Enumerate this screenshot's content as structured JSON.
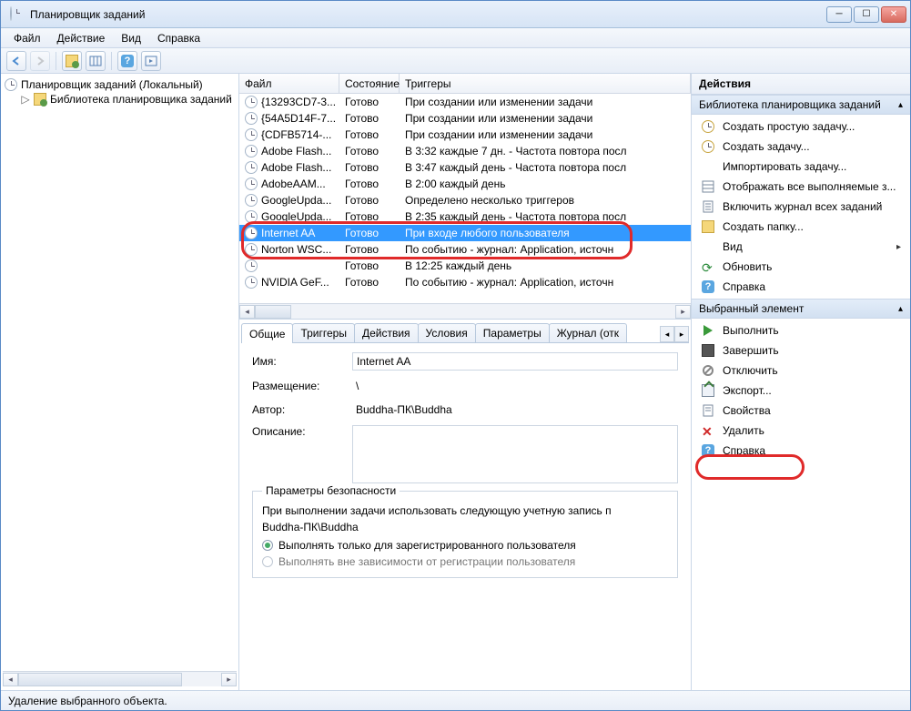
{
  "window": {
    "title": "Планировщик заданий"
  },
  "menu": {
    "file": "Файл",
    "action": "Действие",
    "view": "Вид",
    "help": "Справка"
  },
  "tree": {
    "root": "Планировщик заданий (Локальный)",
    "child": "Библиотека планировщика заданий"
  },
  "list": {
    "headers": {
      "file": "Файл",
      "state": "Состояние",
      "triggers": "Триггеры"
    },
    "rows": [
      {
        "file": "{13293CD7-3...",
        "state": "Готово",
        "trig": "При создании или изменении задачи"
      },
      {
        "file": "{54A5D14F-7...",
        "state": "Готово",
        "trig": "При создании или изменении задачи"
      },
      {
        "file": "{CDFB5714-...",
        "state": "Готово",
        "trig": "При создании или изменении задачи"
      },
      {
        "file": "Adobe Flash...",
        "state": "Готово",
        "trig": "В 3:32 каждые 7 дн. - Частота повтора посл"
      },
      {
        "file": "Adobe Flash...",
        "state": "Готово",
        "trig": "В 3:47 каждый день - Частота повтора посл"
      },
      {
        "file": "AdobeAAM...",
        "state": "Готово",
        "trig": "В 2:00 каждый день"
      },
      {
        "file": "GoogleUpda...",
        "state": "Готово",
        "trig": "Определено несколько триггеров"
      },
      {
        "file": "GoogleUpda...",
        "state": "Готово",
        "trig": "В 2:35 каждый день - Частота повтора посл"
      },
      {
        "file": "Internet AA",
        "state": "Готово",
        "trig": "При входе любого пользователя",
        "sel": true
      },
      {
        "file": "Norton WSC...",
        "state": "Готово",
        "trig": "По событию - журнал: Application, источн"
      },
      {
        "file": "",
        "state": "Готово",
        "trig": "В 12:25 каждый день"
      },
      {
        "file": "NVIDIA GeF...",
        "state": "Готово",
        "trig": "По событию - журнал: Application, источн"
      }
    ]
  },
  "tabs": {
    "general": "Общие",
    "triggers": "Триггеры",
    "actions": "Действия",
    "conditions": "Условия",
    "settings": "Параметры",
    "history": "Журнал (отк"
  },
  "general": {
    "name_lbl": "Имя:",
    "name_val": "Internet AA",
    "loc_lbl": "Размещение:",
    "loc_val": "\\",
    "author_lbl": "Автор:",
    "author_val": "Buddha-ПК\\Buddha",
    "desc_lbl": "Описание:",
    "sec_legend": "Параметры безопасности",
    "sec_text": "При выполнении задачи использовать следующую учетную запись п",
    "sec_account": "Buddha-ПК\\Buddha",
    "radio1": "Выполнять только для зарегистрированного пользователя",
    "radio2": "Выполнять вне зависимости от регистрации пользователя"
  },
  "actions": {
    "paneTitle": "Действия",
    "section1": "Библиотека планировщика заданий",
    "items1": [
      {
        "icon": "clock",
        "label": "Создать простую задачу..."
      },
      {
        "icon": "clocknew",
        "label": "Создать задачу..."
      },
      {
        "icon": "none",
        "label": "Импортировать задачу..."
      },
      {
        "icon": "grid",
        "label": "Отображать все выполняемые з..."
      },
      {
        "icon": "log",
        "label": "Включить журнал всех заданий"
      },
      {
        "icon": "folder",
        "label": "Создать папку..."
      },
      {
        "icon": "none",
        "label": "Вид",
        "sub": true
      },
      {
        "icon": "refresh",
        "label": "Обновить"
      },
      {
        "icon": "help",
        "label": "Справка"
      }
    ],
    "section2": "Выбранный элемент",
    "items2": [
      {
        "icon": "play",
        "label": "Выполнить"
      },
      {
        "icon": "stop",
        "label": "Завершить"
      },
      {
        "icon": "disable",
        "label": "Отключить"
      },
      {
        "icon": "export",
        "label": "Экспорт..."
      },
      {
        "icon": "props",
        "label": "Свойства"
      },
      {
        "icon": "x",
        "label": "Удалить",
        "hl": true
      },
      {
        "icon": "help",
        "label": "Справка"
      }
    ]
  },
  "status": "Удаление выбранного объекта."
}
